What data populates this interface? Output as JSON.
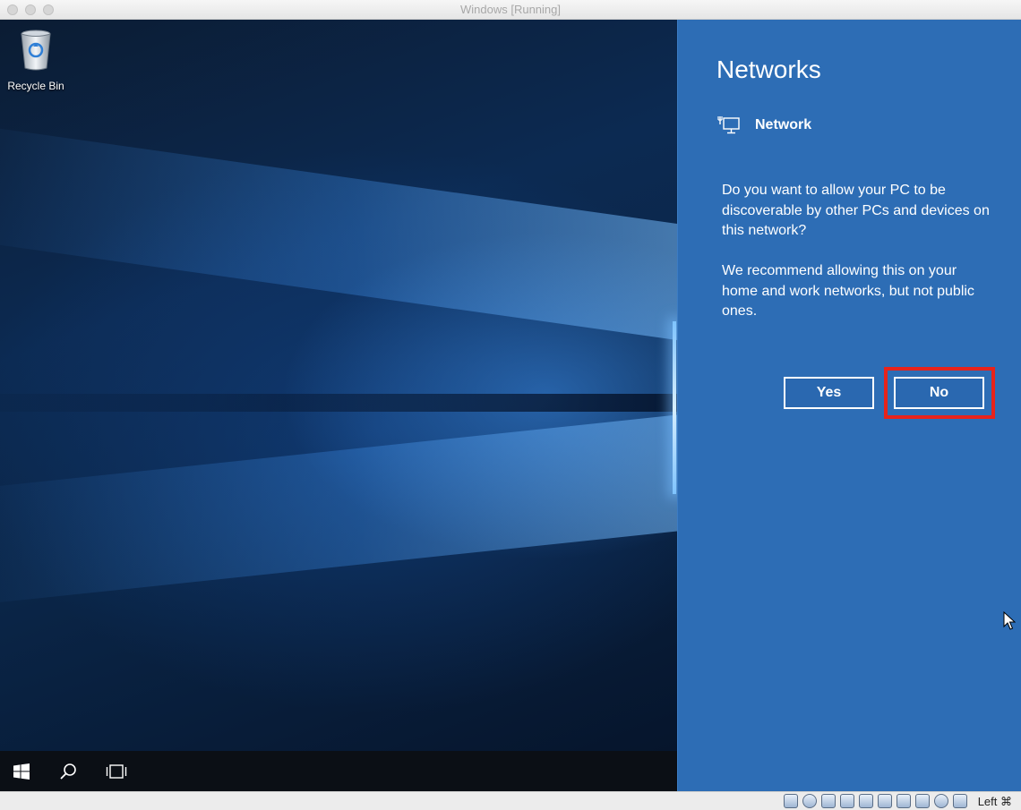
{
  "window": {
    "title": "Windows [Running]"
  },
  "desktop": {
    "icons": [
      {
        "label": "Recycle Bin",
        "icon": "recycle-bin-icon"
      }
    ]
  },
  "taskbar": {
    "items": [
      "windows-start-icon",
      "search-icon",
      "task-view-icon"
    ]
  },
  "networks_panel": {
    "title": "Networks",
    "network_name": "Network",
    "network_icon": "wired-network-icon",
    "question": "Do you want to allow your PC to be discoverable by other PCs and devices on this network?",
    "recommendation": "We recommend allowing this on your home and work networks, but not public ones.",
    "yes_label": "Yes",
    "no_label": "No",
    "highlight_color": "#e8231b",
    "panel_color": "#2d6db5"
  },
  "statusbar": {
    "host_key": "Left ⌘",
    "icons": [
      "hard-disk-icon",
      "optical-drive-icon",
      "network-adapter-icon",
      "pen-icon",
      "shared-folder-icon",
      "display-icon",
      "screen-icon",
      "usb-icon",
      "globe-icon",
      "download-icon"
    ]
  }
}
